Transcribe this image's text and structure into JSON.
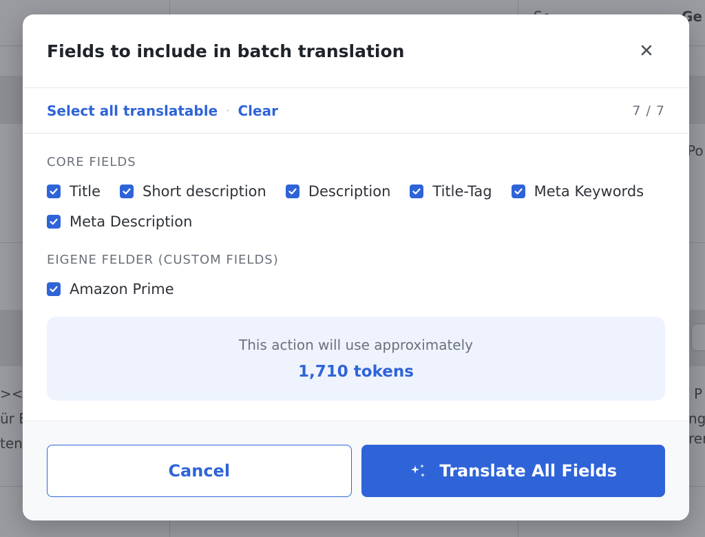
{
  "background": {
    "snippets": [
      "Se",
      "Ge",
      "Po",
      "><li",
      "ür E",
      "ten",
      "P",
      "ng",
      "rer"
    ]
  },
  "modal": {
    "title": "Fields to include in batch translation",
    "close_icon": "close-icon"
  },
  "toolbar": {
    "select_all_label": "Select all translatable",
    "separator": "·",
    "clear_label": "Clear",
    "count": "7 / 7"
  },
  "sections": [
    {
      "title": "CORE FIELDS",
      "fields": [
        {
          "label": "Title",
          "checked": true
        },
        {
          "label": "Short description",
          "checked": true
        },
        {
          "label": "Description",
          "checked": true
        },
        {
          "label": "Title-Tag",
          "checked": true
        },
        {
          "label": "Meta Keywords",
          "checked": true
        },
        {
          "label": "Meta Description",
          "checked": true
        }
      ]
    },
    {
      "title": "EIGENE FELDER (CUSTOM FIELDS)",
      "fields": [
        {
          "label": "Amazon Prime",
          "checked": true
        }
      ]
    }
  ],
  "token_box": {
    "caption": "This action will use approximately",
    "value": "1,710 tokens"
  },
  "footer": {
    "cancel_label": "Cancel",
    "primary_label": "Translate All Fields",
    "primary_icon": "sparkle-icon"
  },
  "colors": {
    "accent": "#2f64d8",
    "token_bg": "#eef3fe"
  }
}
